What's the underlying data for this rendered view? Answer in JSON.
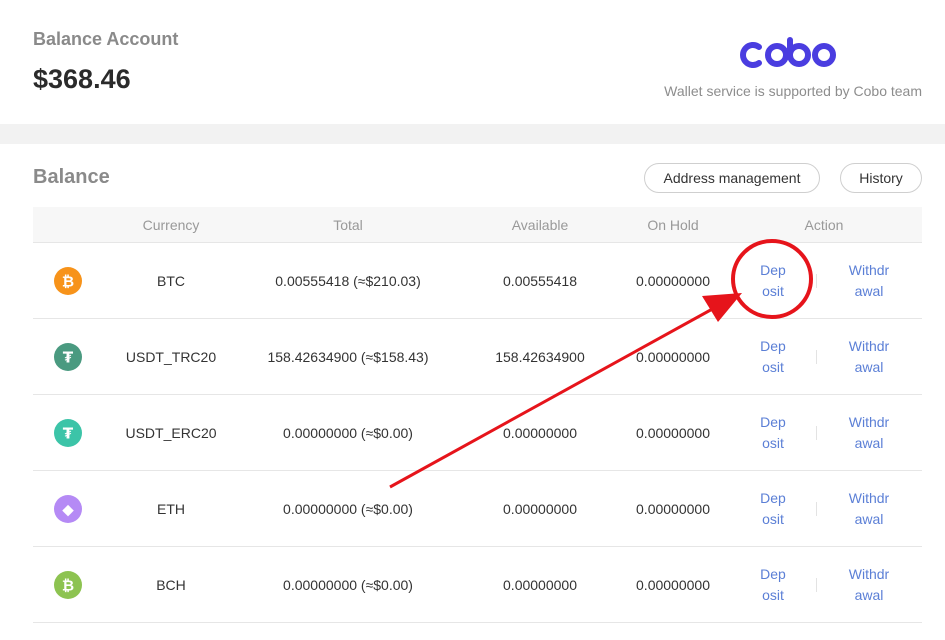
{
  "header": {
    "title": "Balance Account",
    "amount": "$368.46",
    "brand": "cobo",
    "subtitle": "Wallet service is supported by Cobo team"
  },
  "balance": {
    "title": "Balance",
    "address_button": "Address management",
    "history_button": "History",
    "columns": [
      "Currency",
      "Total",
      "Available",
      "On Hold",
      "Action"
    ],
    "rows": [
      {
        "currency": "BTC",
        "total": "0.00555418 (≈$210.03)",
        "available": "0.00555418",
        "on_hold": "0.00000000",
        "deposit": [
          "Dep",
          "osit"
        ],
        "withdraw": [
          "Withdr",
          "awal"
        ],
        "icon": "bitcoin-icon",
        "icon_color": "#f7931a",
        "glyph": "₿"
      },
      {
        "currency": "USDT_TRC20",
        "total": "158.42634900 (≈$158.43)",
        "available": "158.42634900",
        "on_hold": "0.00000000",
        "deposit": [
          "Dep",
          "osit"
        ],
        "withdraw": [
          "Withdr",
          "awal"
        ],
        "icon": "tether-icon",
        "icon_color": "#4a9a80",
        "glyph": "₮"
      },
      {
        "currency": "USDT_ERC20",
        "total": "0.00000000 (≈$0.00)",
        "available": "0.00000000",
        "on_hold": "0.00000000",
        "deposit": [
          "Dep",
          "osit"
        ],
        "withdraw": [
          "Withdr",
          "awal"
        ],
        "icon": "tether-icon",
        "icon_color": "#3cc4a8",
        "glyph": "₮"
      },
      {
        "currency": "ETH",
        "total": "0.00000000 (≈$0.00)",
        "available": "0.00000000",
        "on_hold": "0.00000000",
        "deposit": [
          "Dep",
          "osit"
        ],
        "withdraw": [
          "Withdr",
          "awal"
        ],
        "icon": "ethereum-icon",
        "icon_color": "#b58af5",
        "glyph": "◆"
      },
      {
        "currency": "BCH",
        "total": "0.00000000 (≈$0.00)",
        "available": "0.00000000",
        "on_hold": "0.00000000",
        "deposit": [
          "Dep",
          "osit"
        ],
        "withdraw": [
          "Withdr",
          "awal"
        ],
        "icon": "bitcoin-cash-icon",
        "icon_color": "#8dc351",
        "glyph": "₿"
      }
    ]
  },
  "colors": {
    "brand": "#4a3de0",
    "link": "#5b7fd6",
    "annotation": "#e6141b"
  }
}
